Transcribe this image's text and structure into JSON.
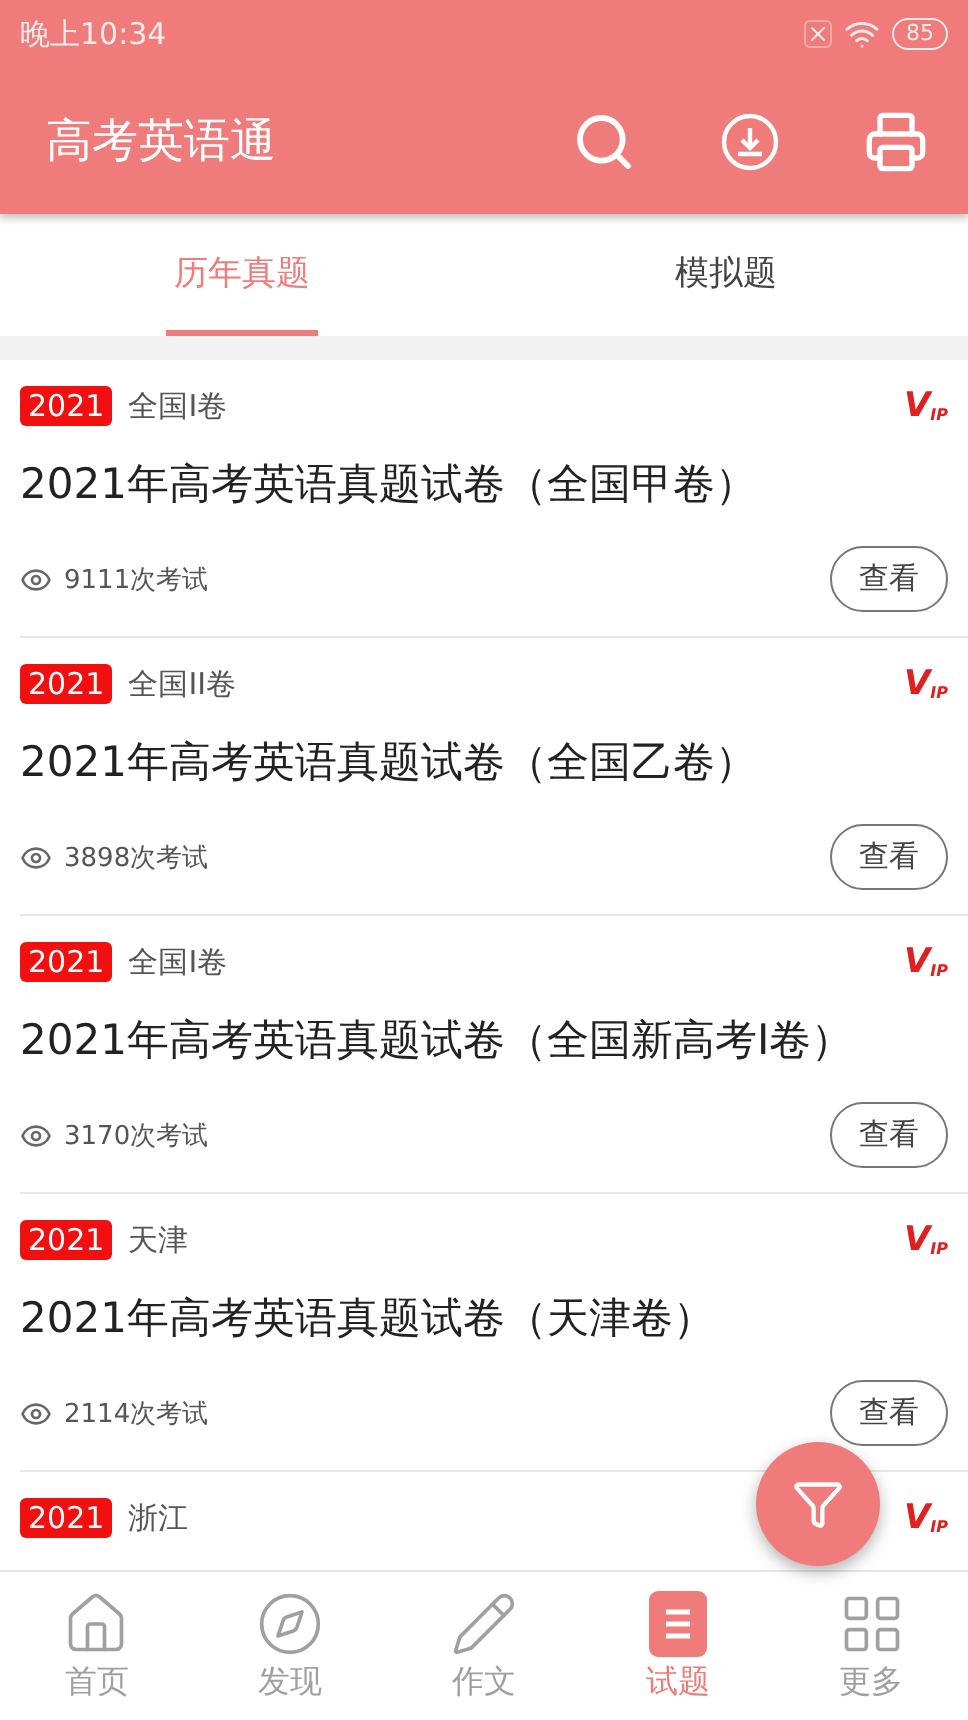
{
  "status_bar": {
    "time": "晚上10:34",
    "battery": "85"
  },
  "app_bar": {
    "title": "高考英语通"
  },
  "tabs": [
    {
      "label": "历年真题",
      "selected": true
    },
    {
      "label": "模拟题",
      "selected": false
    }
  ],
  "papers": [
    {
      "year": "2021",
      "region": "全国I卷",
      "vip": [
        "V",
        "IP"
      ],
      "title": "2021年高考英语真题试卷（全国甲卷）",
      "count": "9111次考试",
      "action": "查看"
    },
    {
      "year": "2021",
      "region": "全国II卷",
      "vip": [
        "V",
        "IP"
      ],
      "title": "2021年高考英语真题试卷（全国乙卷）",
      "count": "3898次考试",
      "action": "查看"
    },
    {
      "year": "2021",
      "region": "全国I卷",
      "vip": [
        "V",
        "IP"
      ],
      "title": "2021年高考英语真题试卷（全国新高考I卷）",
      "count": "3170次考试",
      "action": "查看"
    },
    {
      "year": "2021",
      "region": "天津",
      "vip": [
        "V",
        "IP"
      ],
      "title": "2021年高考英语真题试卷（天津卷）",
      "count": "2114次考试",
      "action": "查看"
    },
    {
      "year": "2021",
      "region": "浙江",
      "vip": [
        "V",
        "IP"
      ]
    }
  ],
  "nav": [
    {
      "kind": "home",
      "label": "首页",
      "selected": false
    },
    {
      "kind": "discover",
      "label": "发现",
      "selected": false
    },
    {
      "kind": "write",
      "label": "作文",
      "selected": false
    },
    {
      "kind": "exam",
      "label": "试题",
      "selected": true
    },
    {
      "kind": "more",
      "label": "更多",
      "selected": false
    }
  ]
}
